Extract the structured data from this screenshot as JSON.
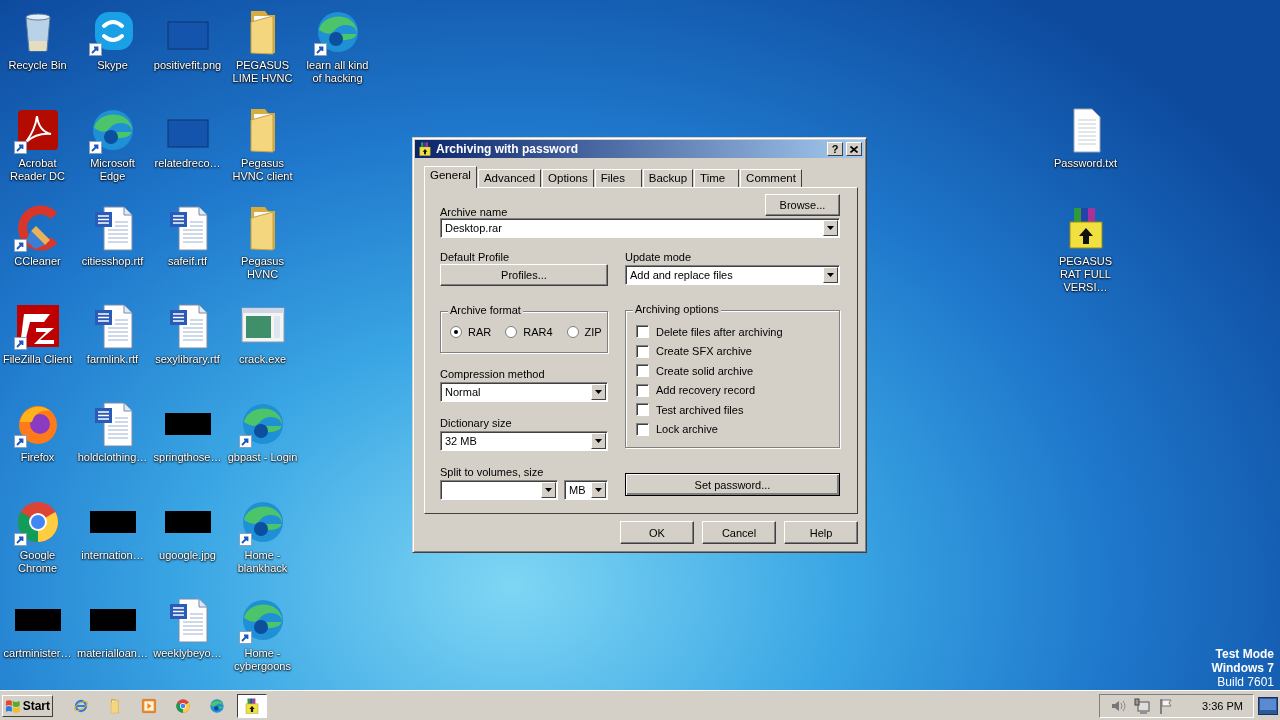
{
  "desktop": {
    "columns": [
      [
        {
          "label": "Recycle Bin",
          "kind": "recycle-bin",
          "shortcut": false
        },
        {
          "label": "Acrobat Reader DC",
          "kind": "acrobat",
          "shortcut": true
        },
        {
          "label": "CCleaner",
          "kind": "ccleaner",
          "shortcut": true
        },
        {
          "label": "FileZilla Client",
          "kind": "filezilla",
          "shortcut": true
        },
        {
          "label": "Firefox",
          "kind": "firefox",
          "shortcut": true
        },
        {
          "label": "Google Chrome",
          "kind": "chrome",
          "shortcut": true
        },
        {
          "label": "cartminister…",
          "kind": "black-thumb",
          "shortcut": false
        }
      ],
      [
        {
          "label": "Skype",
          "kind": "skype",
          "shortcut": true
        },
        {
          "label": "Microsoft Edge",
          "kind": "edge",
          "shortcut": true
        },
        {
          "label": "citiesshop.rtf",
          "kind": "word",
          "shortcut": false
        },
        {
          "label": "farmlink.rtf",
          "kind": "word",
          "shortcut": false
        },
        {
          "label": "holdclothing…",
          "kind": "word",
          "shortcut": false
        },
        {
          "label": "internation…",
          "kind": "black-thumb",
          "shortcut": false
        },
        {
          "label": "materialloan…",
          "kind": "black-thumb",
          "shortcut": false
        }
      ],
      [
        {
          "label": "positivefit.png",
          "kind": "blank-thumb",
          "shortcut": false
        },
        {
          "label": "relatedreco…",
          "kind": "blank-thumb",
          "shortcut": false
        },
        {
          "label": "safeif.rtf",
          "kind": "word",
          "shortcut": false
        },
        {
          "label": "sexylibrary.rtf",
          "kind": "word",
          "shortcut": false
        },
        {
          "label": "springthose…",
          "kind": "black-thumb",
          "shortcut": false
        },
        {
          "label": "ugoogle.jpg",
          "kind": "black-thumb",
          "shortcut": false
        },
        {
          "label": "weeklybeyo…",
          "kind": "word",
          "shortcut": false
        }
      ],
      [
        {
          "label": "PEGASUS LIME HVNC",
          "kind": "folder",
          "shortcut": false
        },
        {
          "label": "Pegasus HVNC client",
          "kind": "folder",
          "shortcut": false
        },
        {
          "label": "Pegasus HVNC",
          "kind": "folder",
          "shortcut": false
        },
        {
          "label": "crack.exe",
          "kind": "exe",
          "shortcut": false
        },
        {
          "label": "gbpast - Login",
          "kind": "edge",
          "shortcut": true
        },
        {
          "label": "Home - blankhack",
          "kind": "edge",
          "shortcut": true
        },
        {
          "label": "Home - cybergoons",
          "kind": "edge",
          "shortcut": true
        }
      ],
      [
        {
          "label": "learn all kind of hacking",
          "kind": "edge",
          "shortcut": true
        }
      ]
    ],
    "right_column": [
      {
        "label": "Password.txt",
        "kind": "text-file",
        "shortcut": false
      },
      {
        "label": "PEGASUS RAT FULL VERSI…",
        "kind": "winrar-archive",
        "shortcut": false
      }
    ],
    "watermark_lines": [
      "Test Mode",
      "Windows 7",
      "Build 7601"
    ]
  },
  "dialog": {
    "title": "Archiving with password",
    "help_button": "?",
    "tabs": [
      {
        "label": "General",
        "selected": true
      },
      {
        "label": "Advanced",
        "selected": false
      },
      {
        "label": "Options",
        "selected": false
      },
      {
        "label": "Files",
        "selected": false
      },
      {
        "label": "Backup",
        "selected": false
      },
      {
        "label": "Time",
        "selected": false
      },
      {
        "label": "Comment",
        "selected": false
      }
    ],
    "archive_name": {
      "label": "Archive name",
      "value": "Desktop.rar",
      "browse": "Browse..."
    },
    "default_profile": {
      "label": "Default Profile",
      "button": "Profiles..."
    },
    "update_mode": {
      "label": "Update mode",
      "value": "Add and replace files"
    },
    "archive_format": {
      "title": "Archive format",
      "options": [
        {
          "label": "RAR",
          "selected": true
        },
        {
          "label": "RAR4",
          "selected": false
        },
        {
          "label": "ZIP",
          "selected": false
        }
      ]
    },
    "compression_method": {
      "label": "Compression method",
      "value": "Normal"
    },
    "dictionary_size": {
      "label": "Dictionary size",
      "value": "32 MB"
    },
    "split_volumes": {
      "label": "Split to volumes, size",
      "unit": "MB"
    },
    "archiving_options": {
      "title": "Archiving options",
      "items": [
        {
          "label": "Delete files after archiving",
          "checked": false
        },
        {
          "label": "Create SFX archive",
          "checked": false
        },
        {
          "label": "Create solid archive",
          "checked": false
        },
        {
          "label": "Add recovery record",
          "checked": false
        },
        {
          "label": "Test archived files",
          "checked": false
        },
        {
          "label": "Lock archive",
          "checked": false
        }
      ]
    },
    "set_password": "Set password...",
    "buttons": [
      "OK",
      "Cancel",
      "Help"
    ]
  },
  "taskbar": {
    "start": "Start",
    "quick_launch": [
      {
        "kind": "ie"
      },
      {
        "kind": "folder"
      },
      {
        "kind": "media"
      },
      {
        "kind": "chrome"
      },
      {
        "kind": "edge"
      }
    ],
    "tasks": [
      {
        "kind": "winrar-archive",
        "selected": true
      }
    ],
    "tray": {
      "clock": "3:36 PM"
    }
  }
}
